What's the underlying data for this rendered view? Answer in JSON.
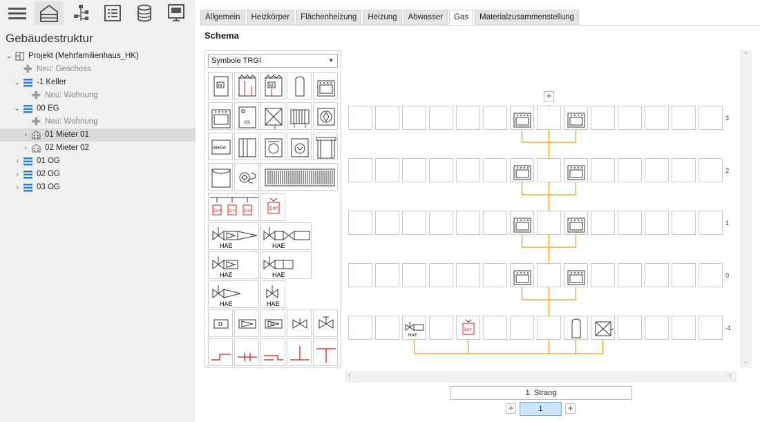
{
  "left_panel": {
    "title": "Gebäudestruktur",
    "toolbar": [
      "hamburger-menu-icon",
      "building-icon",
      "tree-structure-icon",
      "list-icon",
      "database-icon",
      "monitor-icon"
    ],
    "tree": [
      {
        "label": "Projekt (Mehrfamilienhaus_HK)",
        "level": 0,
        "icon": "project-icon",
        "expanded": true
      },
      {
        "label": "Neu: Geschoss",
        "level": 1,
        "icon": "add-icon",
        "dim": true
      },
      {
        "label": "-1 Keller",
        "level": 1,
        "icon": "floor-icon",
        "expanded": true
      },
      {
        "label": "Neu: Wohnung",
        "level": 2,
        "icon": "add-icon",
        "dim": true
      },
      {
        "label": "00 EG",
        "level": 1,
        "icon": "floor-icon",
        "expanded": true
      },
      {
        "label": "Neu: Wohnung",
        "level": 2,
        "icon": "add-icon",
        "dim": true
      },
      {
        "label": "01 Mieter 01",
        "level": 2,
        "icon": "apartment-icon",
        "expanded": false,
        "selected": true
      },
      {
        "label": "02 Mieter 02",
        "level": 2,
        "icon": "apartment-icon",
        "expanded": false
      },
      {
        "label": "01 OG",
        "level": 1,
        "icon": "floor-icon",
        "expanded": false
      },
      {
        "label": "02 OG",
        "level": 1,
        "icon": "floor-icon",
        "expanded": false
      },
      {
        "label": "03 OG",
        "level": 1,
        "icon": "floor-icon",
        "expanded": false
      }
    ]
  },
  "tabs": [
    "Allgemein",
    "Heizkörper",
    "Flächenheizung",
    "Heizung",
    "Abwasser",
    "Gas",
    "Materialzusammenstellung"
  ],
  "active_tab": "Gas",
  "schema_title": "Schema",
  "palette": {
    "selected_value": "Symbole TRGI",
    "hae_label": "HAE",
    "ks_label": "KS",
    "bhkw_label": "BHKW"
  },
  "grid": {
    "levels": [
      "3",
      "2",
      "1",
      "0",
      "-1"
    ],
    "hae_small": "HAE"
  },
  "strang_label": "1. Strang",
  "page_number": "1",
  "colors": {
    "pipe": "#e0a010",
    "accent_red": "#cc2222",
    "selected_tab": "#ffffff"
  }
}
